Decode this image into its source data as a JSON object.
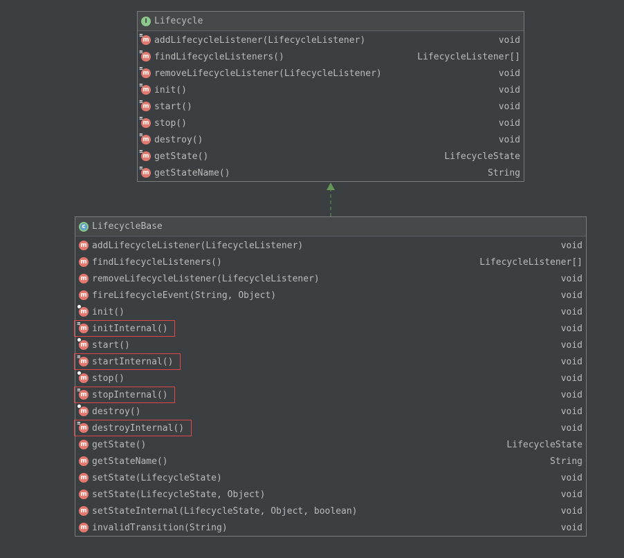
{
  "interface": {
    "title": "Lifecycle",
    "kind_icon": "interface-icon",
    "methods": [
      {
        "name": "addLifecycleListener(LifecycleListener)",
        "type": "void",
        "icon": "abstract-method-icon"
      },
      {
        "name": "findLifecycleListeners()",
        "type": "LifecycleListener[]",
        "icon": "abstract-method-icon"
      },
      {
        "name": "removeLifecycleListener(LifecycleListener)",
        "type": "void",
        "icon": "abstract-method-icon"
      },
      {
        "name": "init()",
        "type": "void",
        "icon": "abstract-method-icon"
      },
      {
        "name": "start()",
        "type": "void",
        "icon": "abstract-method-icon"
      },
      {
        "name": "stop()",
        "type": "void",
        "icon": "abstract-method-icon"
      },
      {
        "name": "destroy()",
        "type": "void",
        "icon": "abstract-method-icon"
      },
      {
        "name": "getState()",
        "type": "LifecycleState",
        "icon": "abstract-method-icon"
      },
      {
        "name": "getStateName()",
        "type": "String",
        "icon": "abstract-method-icon"
      }
    ]
  },
  "class": {
    "title": "LifecycleBase",
    "kind_icon": "abstract-class-icon",
    "methods": [
      {
        "name": "addLifecycleListener(LifecycleListener)",
        "type": "void",
        "icon": "method-icon",
        "highlighted": false
      },
      {
        "name": "findLifecycleListeners()",
        "type": "LifecycleListener[]",
        "icon": "method-icon",
        "highlighted": false
      },
      {
        "name": "removeLifecycleListener(LifecycleListener)",
        "type": "void",
        "icon": "method-icon",
        "highlighted": false
      },
      {
        "name": "fireLifecycleEvent(String, Object)",
        "type": "void",
        "icon": "method-icon",
        "highlighted": false
      },
      {
        "name": "init()",
        "type": "void",
        "icon": "final-method-icon",
        "highlighted": false
      },
      {
        "name": "initInternal()",
        "type": "void",
        "icon": "abstract-method-icon",
        "highlighted": true
      },
      {
        "name": "start()",
        "type": "void",
        "icon": "final-method-icon",
        "highlighted": false
      },
      {
        "name": "startInternal()",
        "type": "void",
        "icon": "abstract-method-icon",
        "highlighted": true
      },
      {
        "name": "stop()",
        "type": "void",
        "icon": "final-method-icon",
        "highlighted": false
      },
      {
        "name": "stopInternal()",
        "type": "void",
        "icon": "abstract-method-icon",
        "highlighted": true
      },
      {
        "name": "destroy()",
        "type": "void",
        "icon": "final-method-icon",
        "highlighted": false
      },
      {
        "name": "destroyInternal()",
        "type": "void",
        "icon": "abstract-method-icon",
        "highlighted": true
      },
      {
        "name": "getState()",
        "type": "LifecycleState",
        "icon": "method-icon",
        "highlighted": false
      },
      {
        "name": "getStateName()",
        "type": "String",
        "icon": "method-icon",
        "highlighted": false
      },
      {
        "name": "setState(LifecycleState)",
        "type": "void",
        "icon": "method-icon",
        "highlighted": false
      },
      {
        "name": "setState(LifecycleState, Object)",
        "type": "void",
        "icon": "method-icon",
        "highlighted": false
      },
      {
        "name": "setStateInternal(LifecycleState, Object, boolean)",
        "type": "void",
        "icon": "method-icon",
        "highlighted": false
      },
      {
        "name": "invalidTransition(String)",
        "type": "void",
        "icon": "method-icon",
        "highlighted": false
      }
    ]
  },
  "relation": {
    "type": "implements",
    "from": "LifecycleBase",
    "to": "Lifecycle"
  },
  "colors": {
    "background": "#3c3f41",
    "method_badge": "#e2786e",
    "interface_badge": "#8cc88c",
    "highlight_border": "#e0484a",
    "arrow": "#629755"
  }
}
